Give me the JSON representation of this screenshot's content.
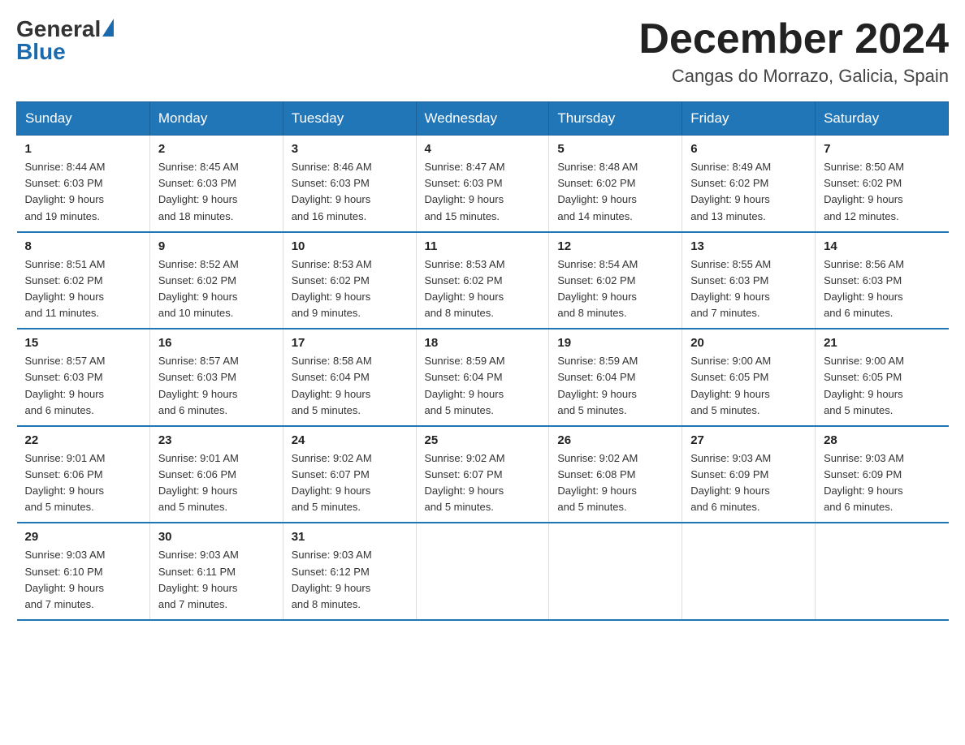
{
  "header": {
    "logo_general": "General",
    "logo_blue": "Blue",
    "title": "December 2024",
    "subtitle": "Cangas do Morrazo, Galicia, Spain"
  },
  "days_of_week": [
    "Sunday",
    "Monday",
    "Tuesday",
    "Wednesday",
    "Thursday",
    "Friday",
    "Saturday"
  ],
  "weeks": [
    [
      {
        "day": "1",
        "sunrise": "8:44 AM",
        "sunset": "6:03 PM",
        "daylight": "9 hours and 19 minutes."
      },
      {
        "day": "2",
        "sunrise": "8:45 AM",
        "sunset": "6:03 PM",
        "daylight": "9 hours and 18 minutes."
      },
      {
        "day": "3",
        "sunrise": "8:46 AM",
        "sunset": "6:03 PM",
        "daylight": "9 hours and 16 minutes."
      },
      {
        "day": "4",
        "sunrise": "8:47 AM",
        "sunset": "6:03 PM",
        "daylight": "9 hours and 15 minutes."
      },
      {
        "day": "5",
        "sunrise": "8:48 AM",
        "sunset": "6:02 PM",
        "daylight": "9 hours and 14 minutes."
      },
      {
        "day": "6",
        "sunrise": "8:49 AM",
        "sunset": "6:02 PM",
        "daylight": "9 hours and 13 minutes."
      },
      {
        "day": "7",
        "sunrise": "8:50 AM",
        "sunset": "6:02 PM",
        "daylight": "9 hours and 12 minutes."
      }
    ],
    [
      {
        "day": "8",
        "sunrise": "8:51 AM",
        "sunset": "6:02 PM",
        "daylight": "9 hours and 11 minutes."
      },
      {
        "day": "9",
        "sunrise": "8:52 AM",
        "sunset": "6:02 PM",
        "daylight": "9 hours and 10 minutes."
      },
      {
        "day": "10",
        "sunrise": "8:53 AM",
        "sunset": "6:02 PM",
        "daylight": "9 hours and 9 minutes."
      },
      {
        "day": "11",
        "sunrise": "8:53 AM",
        "sunset": "6:02 PM",
        "daylight": "9 hours and 8 minutes."
      },
      {
        "day": "12",
        "sunrise": "8:54 AM",
        "sunset": "6:02 PM",
        "daylight": "9 hours and 8 minutes."
      },
      {
        "day": "13",
        "sunrise": "8:55 AM",
        "sunset": "6:03 PM",
        "daylight": "9 hours and 7 minutes."
      },
      {
        "day": "14",
        "sunrise": "8:56 AM",
        "sunset": "6:03 PM",
        "daylight": "9 hours and 6 minutes."
      }
    ],
    [
      {
        "day": "15",
        "sunrise": "8:57 AM",
        "sunset": "6:03 PM",
        "daylight": "9 hours and 6 minutes."
      },
      {
        "day": "16",
        "sunrise": "8:57 AM",
        "sunset": "6:03 PM",
        "daylight": "9 hours and 6 minutes."
      },
      {
        "day": "17",
        "sunrise": "8:58 AM",
        "sunset": "6:04 PM",
        "daylight": "9 hours and 5 minutes."
      },
      {
        "day": "18",
        "sunrise": "8:59 AM",
        "sunset": "6:04 PM",
        "daylight": "9 hours and 5 minutes."
      },
      {
        "day": "19",
        "sunrise": "8:59 AM",
        "sunset": "6:04 PM",
        "daylight": "9 hours and 5 minutes."
      },
      {
        "day": "20",
        "sunrise": "9:00 AM",
        "sunset": "6:05 PM",
        "daylight": "9 hours and 5 minutes."
      },
      {
        "day": "21",
        "sunrise": "9:00 AM",
        "sunset": "6:05 PM",
        "daylight": "9 hours and 5 minutes."
      }
    ],
    [
      {
        "day": "22",
        "sunrise": "9:01 AM",
        "sunset": "6:06 PM",
        "daylight": "9 hours and 5 minutes."
      },
      {
        "day": "23",
        "sunrise": "9:01 AM",
        "sunset": "6:06 PM",
        "daylight": "9 hours and 5 minutes."
      },
      {
        "day": "24",
        "sunrise": "9:02 AM",
        "sunset": "6:07 PM",
        "daylight": "9 hours and 5 minutes."
      },
      {
        "day": "25",
        "sunrise": "9:02 AM",
        "sunset": "6:07 PM",
        "daylight": "9 hours and 5 minutes."
      },
      {
        "day": "26",
        "sunrise": "9:02 AM",
        "sunset": "6:08 PM",
        "daylight": "9 hours and 5 minutes."
      },
      {
        "day": "27",
        "sunrise": "9:03 AM",
        "sunset": "6:09 PM",
        "daylight": "9 hours and 6 minutes."
      },
      {
        "day": "28",
        "sunrise": "9:03 AM",
        "sunset": "6:09 PM",
        "daylight": "9 hours and 6 minutes."
      }
    ],
    [
      {
        "day": "29",
        "sunrise": "9:03 AM",
        "sunset": "6:10 PM",
        "daylight": "9 hours and 7 minutes."
      },
      {
        "day": "30",
        "sunrise": "9:03 AM",
        "sunset": "6:11 PM",
        "daylight": "9 hours and 7 minutes."
      },
      {
        "day": "31",
        "sunrise": "9:03 AM",
        "sunset": "6:12 PM",
        "daylight": "9 hours and 8 minutes."
      },
      null,
      null,
      null,
      null
    ]
  ],
  "labels": {
    "sunrise": "Sunrise:",
    "sunset": "Sunset:",
    "daylight": "Daylight:"
  }
}
